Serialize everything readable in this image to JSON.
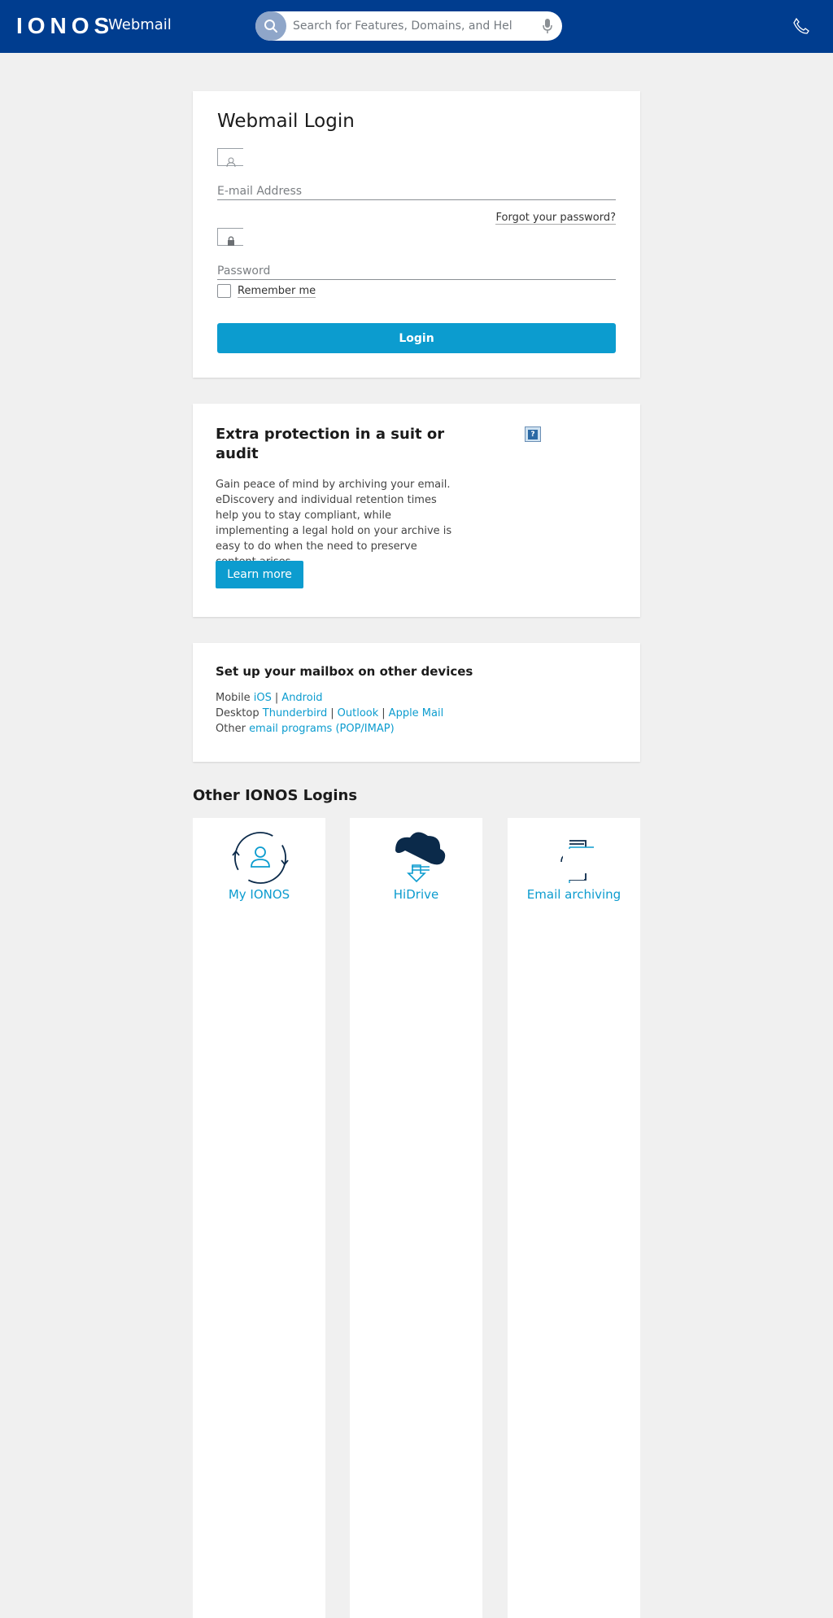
{
  "header": {
    "logo_text": "IONOS",
    "app_title": "Webmail",
    "search_placeholder": "Search for Features, Domains, and Help"
  },
  "login": {
    "title": "Webmail Login",
    "email_placeholder": "E-mail Address",
    "forgot_password": "Forgot your password?",
    "password_placeholder": "Password",
    "remember_me": "Remember me",
    "login_button": "Login"
  },
  "promo": {
    "title": "Extra protection in a suit or audit",
    "text": "Gain peace of mind by archiving your email. eDiscovery and individual retention times help you to stay compliant, while implementing a legal hold on your archive is easy to do when the need to preserve content arises.",
    "button": "Learn more"
  },
  "devices": {
    "title": "Set up your mailbox on other devices",
    "mobile_label": "Mobile",
    "mobile_links": [
      "iOS",
      "Android"
    ],
    "desktop_label": "Desktop",
    "desktop_links": [
      "Thunderbird",
      "Outlook",
      "Apple Mail"
    ],
    "other_label": "Other",
    "other_link": "email programs (POP/IMAP)",
    "separator": "|"
  },
  "other_logins": {
    "title": "Other IONOS Logins",
    "tiles": [
      {
        "label": "My IONOS",
        "icon": "user-sync-icon"
      },
      {
        "label": "HiDrive",
        "icon": "cloud-upload-icon"
      },
      {
        "label": "Email archiving",
        "icon": "archive-icon"
      }
    ]
  },
  "colors": {
    "header_bg": "#003d8f",
    "accent": "#0c9ccf",
    "page_bg": "#f0f0f0"
  }
}
